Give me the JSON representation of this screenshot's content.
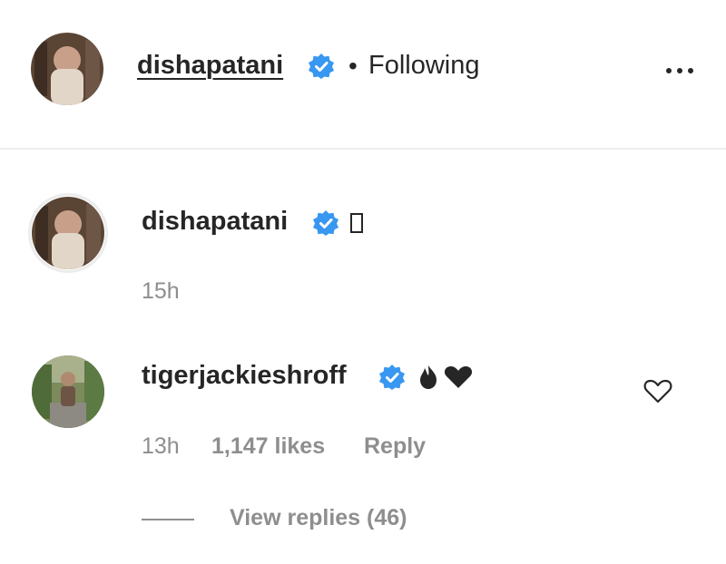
{
  "post_header": {
    "username": "dishapatani",
    "separator": "•",
    "follow_status": "Following",
    "more_icon": "ellipsis-icon"
  },
  "caption": {
    "username": "dishapatani",
    "text_icon": "missing-glyph-box",
    "timestamp": "15h"
  },
  "comment": {
    "username": "tigerjackieshroff",
    "text_icons": [
      "fire-emoji",
      "black-heart-emoji"
    ],
    "timestamp": "13h",
    "likes": "1,147 likes",
    "reply_label": "Reply",
    "view_replies": "View replies (46)",
    "like_icon": "heart-outline-icon"
  },
  "colors": {
    "text_primary": "#262626",
    "text_secondary": "#8e8e8e",
    "verified_blue": "#3897f0",
    "divider": "#efefef"
  }
}
